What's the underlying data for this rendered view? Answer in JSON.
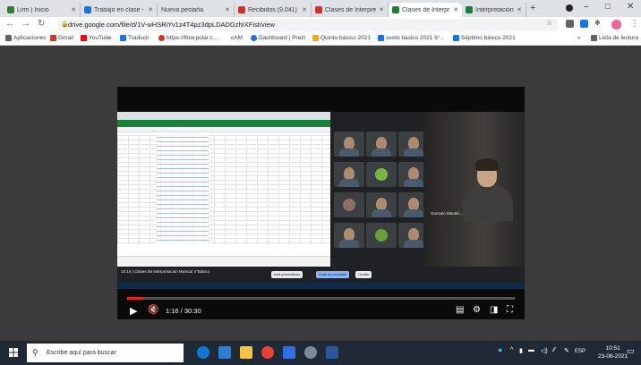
{
  "browser": {
    "tabs": [
      {
        "label": "Lirm | Inicio",
        "favicon_color": "#2e7d32",
        "active": false
      },
      {
        "label": "Trabajo en clase -",
        "favicon_color": "#1a73e8",
        "active": false
      },
      {
        "label": "Nueva pestaña",
        "favicon_color": "#ffffff",
        "active": false
      },
      {
        "label": "Recibidos (9.041)",
        "favicon_color": "#d93025",
        "active": false
      },
      {
        "label": "Clases de Interpre",
        "favicon_color": "#d93025",
        "active": false
      },
      {
        "label": "Clases de Interpr",
        "favicon_color": "#188038",
        "active": true
      },
      {
        "label": "Interpretación M",
        "favicon_color": "#188038",
        "active": false
      }
    ],
    "new_tab": "+",
    "window": {
      "minimize": "–",
      "maximize": "□",
      "close": "✕"
    },
    "nav": {
      "back": "←",
      "forward": "→",
      "reload": "↻"
    },
    "url": "drive.google.com/file/d/1V-wHSRiYv1z4T4pz3dpLDADGzhIXFist/view",
    "bookmarks": [
      {
        "label": "Aplicaciones",
        "color": "#5f6368"
      },
      {
        "label": "Gmail",
        "color": "#d93025"
      },
      {
        "label": "YouTube",
        "color": "#ff0000"
      },
      {
        "label": "Traducir",
        "color": "#1a73e8"
      },
      {
        "label": "https://flow.polar.c...",
        "color": "#d93025"
      },
      {
        "label": "cAM",
        "color": "#ffffff"
      },
      {
        "label": "Dashboard | Prezi",
        "color": "#1a73e8"
      },
      {
        "label": "Quinto básico 2021",
        "color": "#f9ab00"
      },
      {
        "label": "sexto básico 2021 6°...",
        "color": "#1a73e8"
      },
      {
        "label": "Séptimo básico 2021",
        "color": "#1a73e8"
      }
    ],
    "reading_list": "Lista de lectura",
    "more_bookmarks": "»"
  },
  "video": {
    "speaker_name": "Gonzalo Mautel...",
    "meeting_title": "10:16 | Clases de Interpretación Musical 4°Básico",
    "present_notice": "está presentando",
    "present_button": "Dejar de compartir",
    "hide_button": "Ocultar",
    "time_current": "1:16",
    "time_total": "30:30",
    "time_display": "1:16 / 30:30",
    "progress_fraction": 0.042,
    "progress_color": "#e62117"
  },
  "taskbar": {
    "search_placeholder": "Escribe aquí para buscar",
    "lang": "ESP",
    "time": "10:51",
    "date": "23-06-2021",
    "apps": [
      {
        "name": "edge-icon",
        "color": "#0f78d4"
      },
      {
        "name": "store-icon",
        "color": "#2d7dd2"
      },
      {
        "name": "explorer-icon",
        "color": "#f4c542"
      },
      {
        "name": "chrome-icon",
        "color": "#e94235"
      },
      {
        "name": "mail-icon",
        "color": "#2f6fe4"
      },
      {
        "name": "antivirus-icon",
        "color": "#7b8a99"
      },
      {
        "name": "word-icon",
        "color": "#2b579a"
      }
    ]
  }
}
